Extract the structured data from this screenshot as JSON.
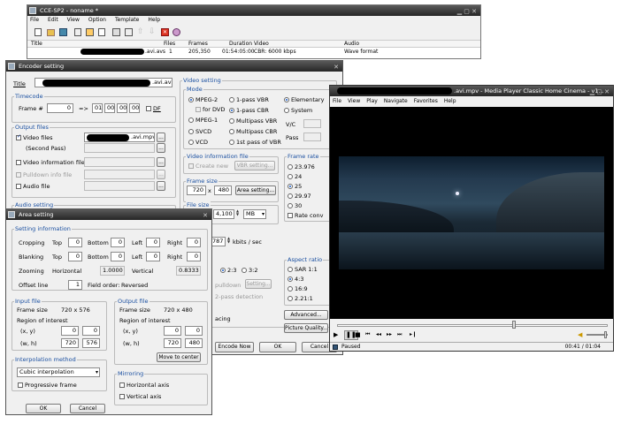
{
  "cce": {
    "title": "CCE-SP2 - noname *",
    "menu": [
      "File",
      "Edit",
      "View",
      "Option",
      "Template",
      "Help"
    ],
    "columns": [
      "Title",
      "Files",
      "Frames",
      "Duration",
      "Video",
      "Audio"
    ],
    "row": {
      "title_suffix": ".avi.avs",
      "files": "1",
      "frames": "205,350",
      "duration": "01:54:05:00",
      "video": "CBR: 6000 kbps",
      "audio": "Wave format"
    }
  },
  "encoder": {
    "title": "Encoder setting",
    "title_label": "Title",
    "title_value": ".avi.avs",
    "timecode": {
      "label": "Timecode",
      "frame_label": "Frame #",
      "frame_value": "0",
      "arrow": "=>",
      "h": "01",
      "m": "00",
      "s": "00",
      "f": "00",
      "df": "DF"
    },
    "output": {
      "label": "Output files",
      "video": "Video files",
      "video_value": ".avi.mpv",
      "second_pass": "(Second Pass)",
      "video_info": "Video information file",
      "pulldown": "Pulldown info file",
      "audio": "Audio file",
      "browse": "..."
    },
    "audio_setting": "Audio setting",
    "video_setting": {
      "label": "Video setting",
      "mode": "Mode",
      "mpeg2": "MPEG-2",
      "for_dvd": "for DVD",
      "mpeg1": "MPEG-1",
      "svcd": "SVCD",
      "vcd": "VCD",
      "vbr1": "1-pass VBR",
      "cbr1": "1-pass CBR",
      "mvbr": "Multipass VBR",
      "mcbr": "Multipass CBR",
      "vbr1st": "1st pass of VBR",
      "elementary": "Elementary",
      "system": "System",
      "vc": "V/C",
      "pass": "Pass"
    },
    "vinfo": {
      "label": "Video information file",
      "create": "Create new",
      "vbr_setting": "VBR setting..."
    },
    "frame_size": {
      "label": "Frame size",
      "w": "720",
      "x": "x",
      "h": "480",
      "btn": "Area setting..."
    },
    "file_size": {
      "label": "File size",
      "value": "4,100",
      "unit": "MB"
    },
    "bitrate": {
      "value": "787",
      "unit": "kbits / sec"
    },
    "frame_rate": {
      "label": "Frame rate",
      "options": [
        "23.976",
        "24",
        "25",
        "29.97",
        "30"
      ],
      "selected": "25",
      "rate_conv": "Rate conv"
    },
    "pulldown": {
      "r23": "2:3",
      "r32": "3:2",
      "pulldown": "pulldown",
      "setting": "Setting...",
      "detect": "2-pass detection",
      "spacing": "acing"
    },
    "aspect": {
      "label": "Aspect ratio",
      "options": [
        "SAR 1:1",
        "4:3",
        "16:9",
        "2.21:1"
      ],
      "selected": "4:3"
    },
    "buttons": {
      "advanced": "Advanced...",
      "picture": "Picture Quality...",
      "encode": "Encode Now",
      "ok": "OK",
      "cancel": "Cancel"
    }
  },
  "area": {
    "title": "Area setting",
    "setting_info": "Setting information",
    "cropping": "Cropping",
    "blanking": "Blanking",
    "top": "Top",
    "bottom": "Bottom",
    "left": "Left",
    "right": "Right",
    "crop": [
      "0",
      "0",
      "0",
      "0"
    ],
    "blank": [
      "0",
      "0",
      "0",
      "0"
    ],
    "zooming": "Zooming",
    "horizontal": "Horizontal",
    "h_zoom": "1.0000",
    "vertical": "Vertical",
    "v_zoom": "0.8333",
    "offset": "Offset line",
    "offset_value": "1",
    "field_order": "Field order:",
    "field_value": "Reversed",
    "input": {
      "label": "Input file",
      "frame_size": "Frame size",
      "frame_value": "720 x 576",
      "roi": "Region of interest",
      "xy": "(x, y)",
      "wh": "(w, h)",
      "x": "0",
      "y": "0",
      "w": "720",
      "h": "576"
    },
    "output": {
      "label": "Output file",
      "frame_size": "Frame size",
      "frame_value": "720 x 480",
      "roi": "Region of interest",
      "xy": "(x, y)",
      "wh": "(w, h)",
      "x": "0",
      "y": "0",
      "w": "720",
      "h": "480",
      "center": "Move to center"
    },
    "interp": {
      "label": "Interpolation method",
      "value": "Cubic interpolation",
      "progressive": "Progressive frame"
    },
    "mirror": {
      "label": "Mirroring",
      "horizontal": "Horizontal axis",
      "vertical": "Vertical axis"
    },
    "ok": "OK",
    "cancel": "Cancel"
  },
  "mpc": {
    "title": ".avi.mpv - Media Player Classic Home Cinema - v1...",
    "menu": [
      "File",
      "View",
      "Play",
      "Navigate",
      "Favorites",
      "Help"
    ],
    "status": "Paused",
    "time": "00:41 / 01:04"
  }
}
